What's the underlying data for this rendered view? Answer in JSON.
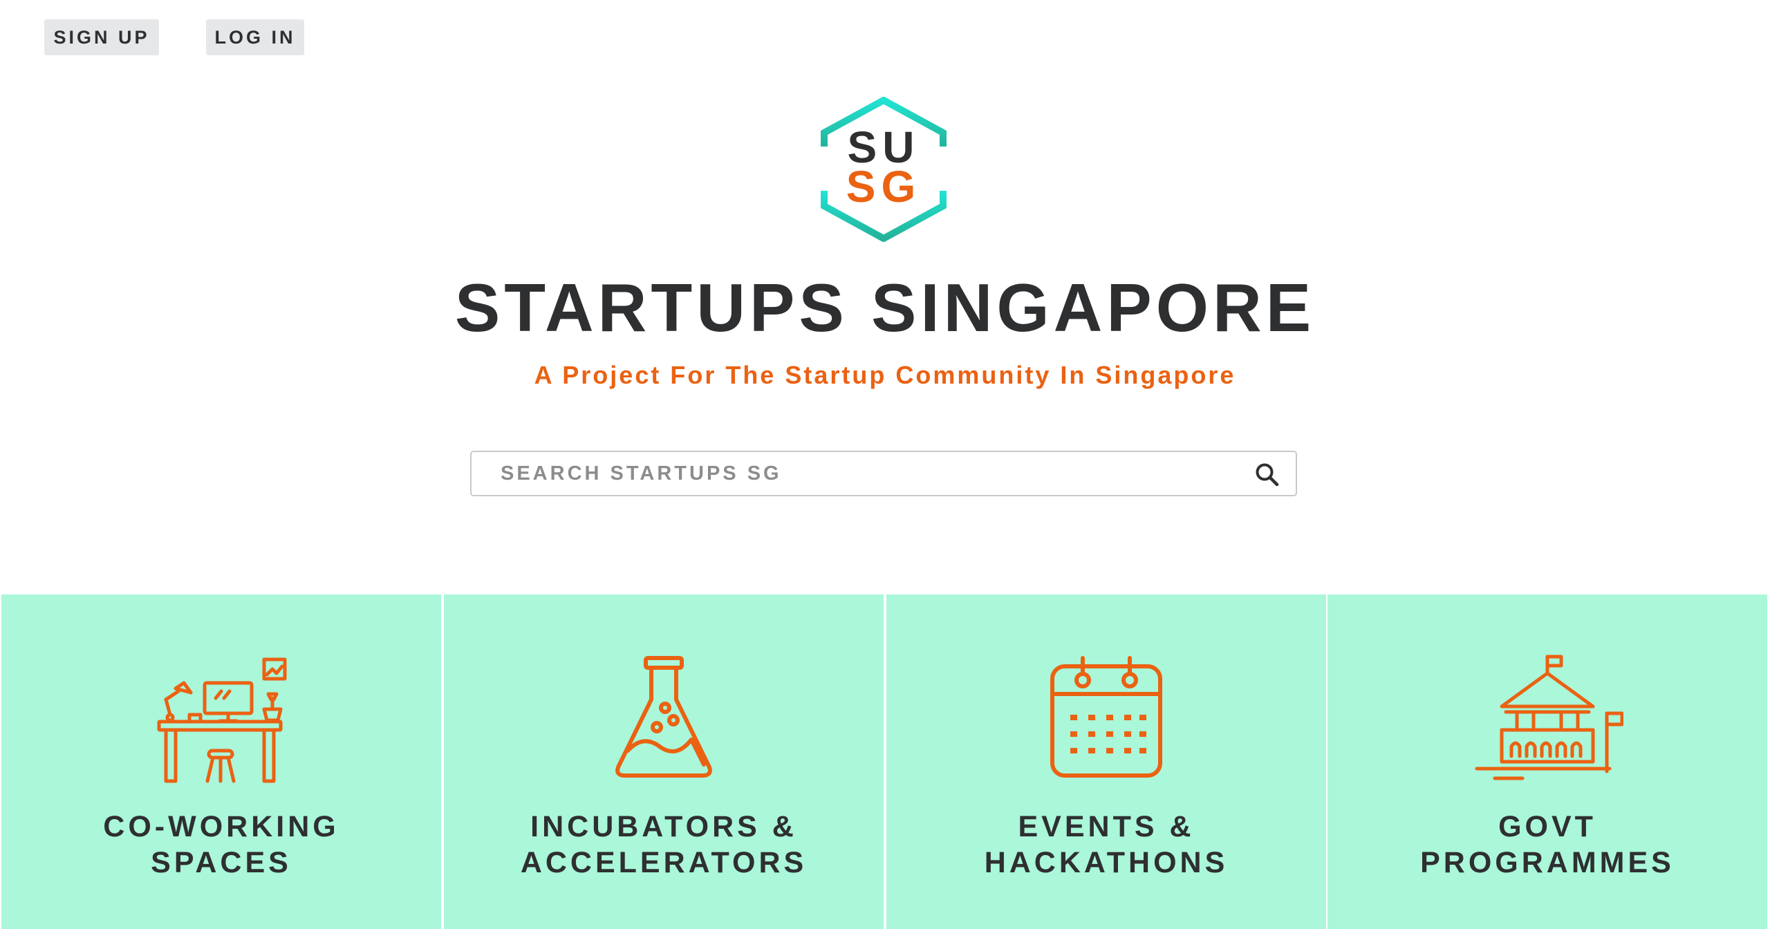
{
  "header": {
    "signup_label": "SIGN UP",
    "login_label": "LOG IN"
  },
  "logo": {
    "line1": "SU",
    "line2": "SG"
  },
  "hero": {
    "title": "STARTUPS SINGAPORE",
    "tagline": "A Project For The Startup Community In Singapore"
  },
  "search": {
    "placeholder": "SEARCH STARTUPS SG",
    "value": "",
    "icon": "search-icon"
  },
  "categories": [
    {
      "icon": "desk-workspace-icon",
      "line1": "CO-WORKING",
      "line2": "SPACES"
    },
    {
      "icon": "lab-flask-icon",
      "line1": "INCUBATORS &",
      "line2": "ACCELERATORS"
    },
    {
      "icon": "calendar-icon",
      "line1": "EVENTS &",
      "line2": "HACKATHONS"
    },
    {
      "icon": "government-building-icon",
      "line1": "GOVT",
      "line2": "PROGRAMMES"
    }
  ],
  "colors": {
    "accent_orange": "#ea6212",
    "text_dark": "#2e2f31",
    "card_mint": "#aaf7da",
    "logo_teal_top": "#22e3d3",
    "logo_teal_bottom": "#23b39a"
  }
}
